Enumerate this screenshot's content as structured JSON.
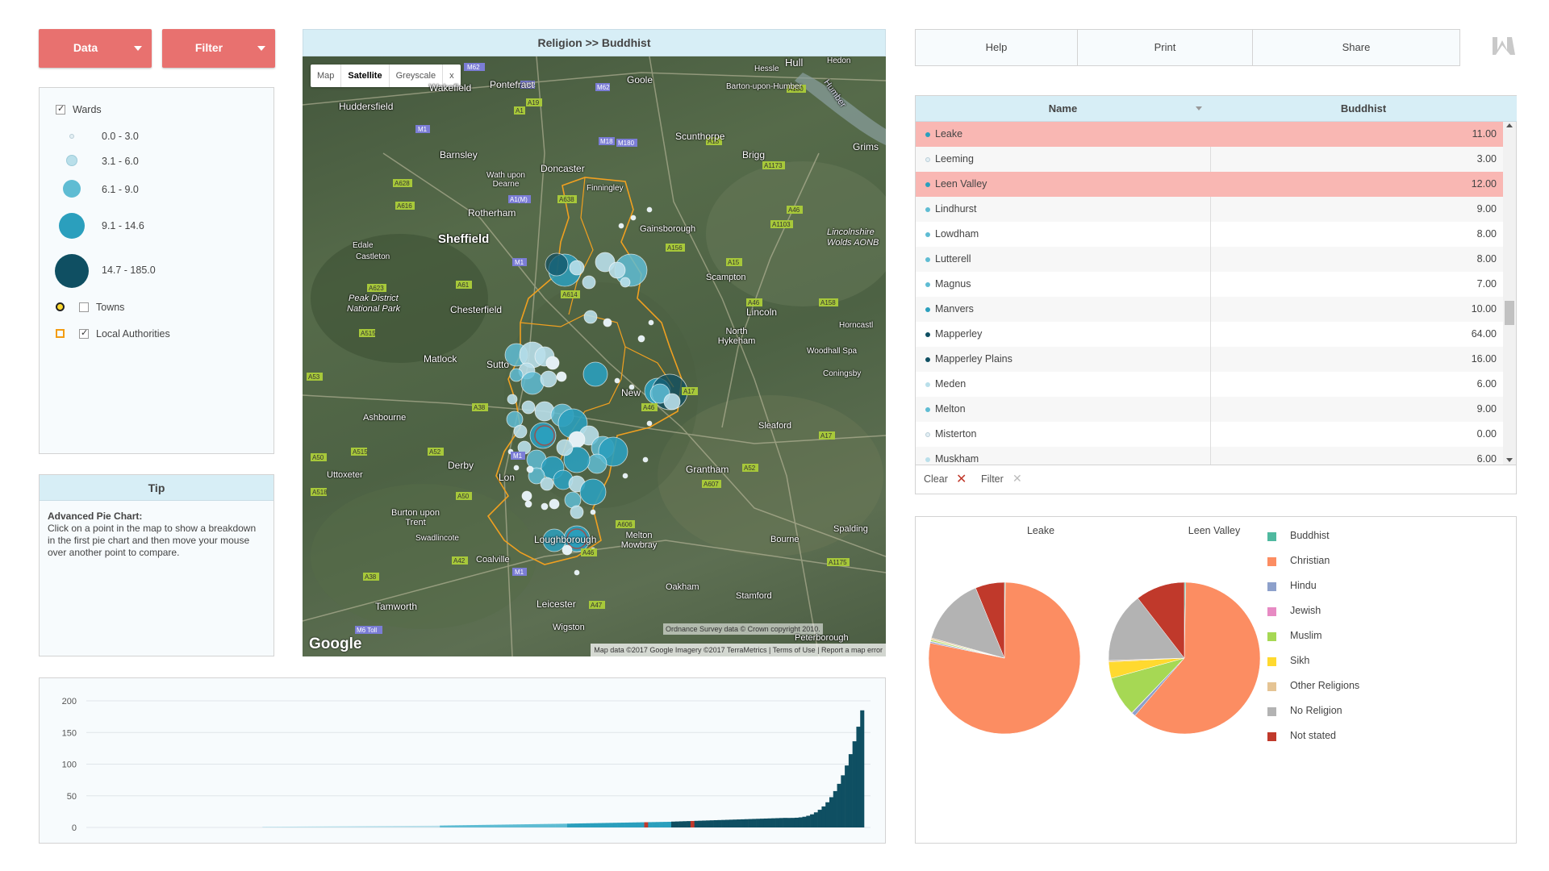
{
  "toolbar": {
    "data_label": "Data",
    "filter_label": "Filter"
  },
  "legend": {
    "wards_label": "Wards",
    "ranges": [
      "0.0 - 3.0",
      "3.1 - 6.0",
      "6.1 - 9.0",
      "9.1 - 14.6",
      "14.7 - 185.0"
    ],
    "range_colors": [
      "#e3eff4",
      "#b9dfea",
      "#5fbcd3",
      "#2b9fbd",
      "#0f4f62"
    ],
    "towns_label": "Towns",
    "towns_checked": false,
    "local_authorities_label": "Local Authorities",
    "local_authorities_checked": true,
    "wards_checked": true
  },
  "tip": {
    "title": "Tip",
    "heading": "Advanced Pie Chart:",
    "body": "Click on a point in the map to show a breakdown in the first pie chart and then move your mouse over another point to compare."
  },
  "map": {
    "title": "Religion >> Buddhist",
    "tabs": [
      "Map",
      "Satellite",
      "Greyscale"
    ],
    "active_tab": "Satellite",
    "close": "x",
    "places": {
      "Huddersfield": "Huddersfield",
      "Wakefield": "Wakefield",
      "Pontefract": "Pontefract",
      "Goole": "Goole",
      "Hessle": "Hessle",
      "Hedon": "Hedon",
      "Barton": "Barton-upon-Humber",
      "Barnsley": "Barnsley",
      "Doncaster": "Doncaster",
      "Scunthorpe": "Scunthorpe",
      "Brigg": "Brigg",
      "Grimsby": "Grims",
      "WathDearne": "Wath upon Dearne",
      "Sheffield": "Sheffield",
      "Rotherham": "Rotherham",
      "Gainsborough": "Gainsborough",
      "Edale": "Edale",
      "Castleton": "Castleton",
      "PeakDistrict": "Peak District",
      "NationalPark": "National Park",
      "Chesterfield": "Chesterfield",
      "Lincoln": "Lincoln",
      "NorthHykeham": "North Hykeham",
      "Matlock": "Matlock",
      "Horncastle": "Horncastl",
      "WoodhallSpa": "Woodhall Spa",
      "Coningsby": "Coningsby",
      "Ashbourne": "Ashbourne",
      "Sleaford": "Sleaford",
      "Uttoxeter": "Uttoxeter",
      "Derby": "Derby",
      "Grantham": "Grantham",
      "BurtonTrent": "Burton upon Trent",
      "Swadlincote": "Swadlincote",
      "Coalville": "Coalville",
      "Loughborough": "Loughborough",
      "MeltonMowbray": "Melton Mowbray",
      "Bourne": "Bourne",
      "Spalding": "Spalding",
      "Tamworth": "Tamworth",
      "Leicester": "Leicester",
      "Wigston": "Wigston",
      "Oakham": "Oakham",
      "Stamford": "Stamford",
      "Peterborough": "Peterborough",
      "Scampton": "Scampton",
      "Finningley": "Finningley",
      "Hull": "Hull",
      "Humber": "Humber",
      "Lincolnshire": "Lincolnshire",
      "WoldsAONB": "Wolds AONB",
      "Newark": "New",
      "Sutton": "Sutto",
      "Long": "Lon"
    },
    "copyright": "Ordnance Survey data © Crown copyright 2010.",
    "footer": "Map data ©2017 Google Imagery ©2017 TerraMetrics   |   Terms of Use   |   Report a map error",
    "google": "Google"
  },
  "actions": {
    "help": "Help",
    "print": "Print",
    "share": "Share"
  },
  "table": {
    "col_name": "Name",
    "col_value": "Buddhist",
    "rows": [
      {
        "name": "Leake",
        "value": "11.00",
        "highlight": true,
        "dot": "#2b9fbd"
      },
      {
        "name": "Leeming",
        "value": "3.00",
        "highlight": false,
        "dot": "#e3eff4"
      },
      {
        "name": "Leen Valley",
        "value": "12.00",
        "highlight": true,
        "dot": "#2b9fbd"
      },
      {
        "name": "Lindhurst",
        "value": "9.00",
        "highlight": false,
        "dot": "#5fbcd3"
      },
      {
        "name": "Lowdham",
        "value": "8.00",
        "highlight": false,
        "dot": "#5fbcd3"
      },
      {
        "name": "Lutterell",
        "value": "8.00",
        "highlight": false,
        "dot": "#5fbcd3"
      },
      {
        "name": "Magnus",
        "value": "7.00",
        "highlight": false,
        "dot": "#5fbcd3"
      },
      {
        "name": "Manvers",
        "value": "10.00",
        "highlight": false,
        "dot": "#2b9fbd"
      },
      {
        "name": "Mapperley",
        "value": "64.00",
        "highlight": false,
        "dot": "#0f4f62"
      },
      {
        "name": "Mapperley Plains",
        "value": "16.00",
        "highlight": false,
        "dot": "#0f4f62"
      },
      {
        "name": "Meden",
        "value": "6.00",
        "highlight": false,
        "dot": "#b9dfea"
      },
      {
        "name": "Melton",
        "value": "9.00",
        "highlight": false,
        "dot": "#5fbcd3"
      },
      {
        "name": "Misterton",
        "value": "0.00",
        "highlight": false,
        "dot": "#e3eff4"
      },
      {
        "name": "Muskham",
        "value": "6.00",
        "highlight": false,
        "dot": "#b9dfea"
      }
    ],
    "clear_label": "Clear",
    "filter_label": "Filter"
  },
  "pies": {
    "pie1_title": "Leake",
    "pie2_title": "Leen Valley",
    "legend": [
      {
        "name": "Buddhist",
        "color": "#4fb99f"
      },
      {
        "name": "Christian",
        "color": "#fc8d62"
      },
      {
        "name": "Hindu",
        "color": "#8da0cb"
      },
      {
        "name": "Jewish",
        "color": "#e78ac3"
      },
      {
        "name": "Muslim",
        "color": "#a6d854"
      },
      {
        "name": "Sikh",
        "color": "#ffd92f"
      },
      {
        "name": "Other Religions",
        "color": "#e5c494"
      },
      {
        "name": "No Religion",
        "color": "#b3b3b3"
      },
      {
        "name": "Not stated",
        "color": "#c0392b"
      }
    ],
    "pie1_values": [
      0.2,
      78.0,
      0.3,
      0.1,
      0.3,
      0.1,
      0.3,
      14.5,
      6.2
    ],
    "pie2_values": [
      0.3,
      61.0,
      0.8,
      0.1,
      8.5,
      3.5,
      0.3,
      15.0,
      10.5
    ]
  },
  "chart_data": {
    "type": "bar",
    "y_ticks": [
      "200",
      "150",
      "100",
      "50",
      "0"
    ],
    "ylim": [
      0,
      200
    ],
    "xlabel": "",
    "ylabel": "",
    "bar_count": 200,
    "band_colors": [
      "#b9dfea",
      "#5fbcd3",
      "#2b9fbd",
      "#0f4f62"
    ],
    "highlight_color": "#c0392b",
    "values_sorted": "ascending ward Buddhist counts from 0 to 185"
  }
}
